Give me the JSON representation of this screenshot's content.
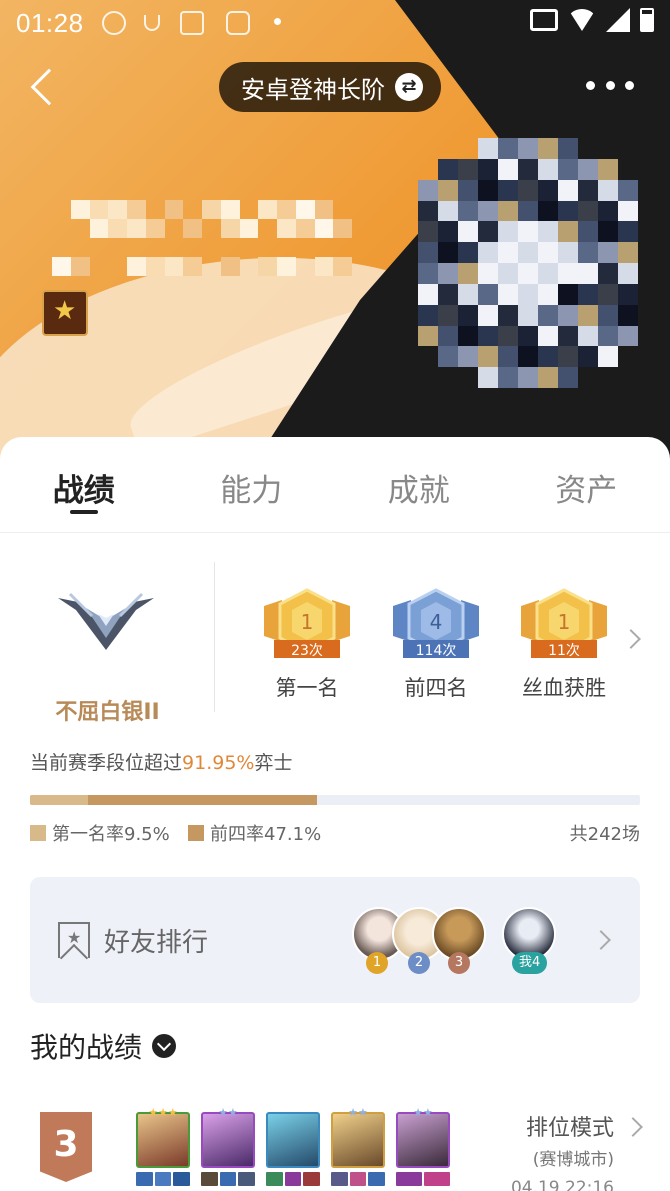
{
  "status_bar": {
    "time": "01:28"
  },
  "header": {
    "title": "安卓登神长阶"
  },
  "tabs": [
    {
      "label": "战绩",
      "active": true
    },
    {
      "label": "能力",
      "active": false
    },
    {
      "label": "成就",
      "active": false
    },
    {
      "label": "资产",
      "active": false
    }
  ],
  "rank": {
    "name": "不屈白银II"
  },
  "medals": [
    {
      "number": "1",
      "count": "23次",
      "label": "第一名"
    },
    {
      "number": "4",
      "count": "114次",
      "label": "前四名"
    },
    {
      "number": "1",
      "count": "11次",
      "label": "丝血获胜"
    }
  ],
  "season": {
    "prefix": "当前赛季段位超过",
    "percent": "91.95%",
    "suffix": "弈士"
  },
  "stats": {
    "first_rate_label": "第一名率9.5%",
    "top4_rate_label": "前四率47.1%",
    "first_rate": 0.095,
    "top4_rate": 0.471,
    "total_label": "共242场"
  },
  "friends": {
    "label": "好友排行",
    "ranks": [
      "1",
      "2",
      "3"
    ],
    "me_label": "我4"
  },
  "records": {
    "title": "我的战绩",
    "items": [
      {
        "place": "3",
        "mode": "排位模式",
        "sub": "(赛博城市)",
        "time": "04.19 22:16"
      }
    ]
  },
  "colors": {
    "accent": "#e0883a",
    "rank_text": "#b88a58",
    "bar_first": "#d7b98a",
    "bar_top4": "#c59862",
    "medal_gold": "#f3c04a",
    "medal_blue": "#7aa0d6"
  }
}
